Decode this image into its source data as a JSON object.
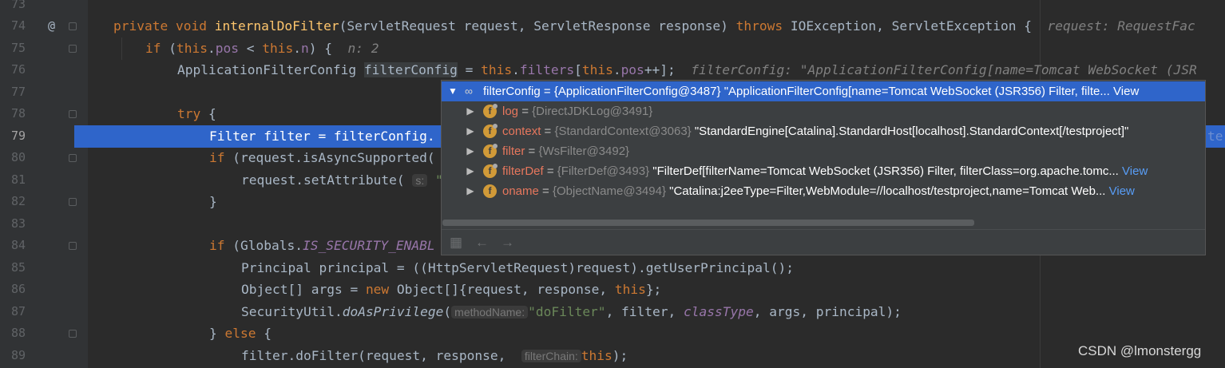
{
  "lines": {
    "l73": "73",
    "l74": "74",
    "l75": "75",
    "l76": "76",
    "l77": "77",
    "l78": "78",
    "l79": "79",
    "l80": "80",
    "l81": "81",
    "l82": "82",
    "l83": "83",
    "l84": "84",
    "l85": "85",
    "l86": "86",
    "l87": "87",
    "l88": "88",
    "l89": "89"
  },
  "gutter_marker": "@",
  "code": {
    "l74": {
      "kw1": "private void ",
      "fn": "internalDoFilter",
      "rest1": "(ServletRequest request, ServletResponse response) ",
      "kw2": "throws",
      "rest2": " IOException, ServletException {",
      "dbg": "request: RequestFac"
    },
    "l75": {
      "kw": "if",
      "rest1": " (",
      "kw2": "this",
      "rest2": ".",
      "fld1": "pos",
      "rest3": " < ",
      "kw3": "this",
      "rest4": ".",
      "fld2": "n",
      "rest5": ") {",
      "dbg": "n: 2"
    },
    "l76": {
      "rest1": "ApplicationFilterConfig ",
      "var": "filterConfig",
      "rest2": " = ",
      "kw": "this",
      "rest3": ".",
      "fld": "filters",
      "rest4": "[",
      "kw2": "this",
      "rest5": ".",
      "fld2": "pos",
      "rest6": "++];",
      "dbg": "filterConfig: \"ApplicationFilterConfig[name=Tomcat WebSocket (JSR"
    },
    "l78": {
      "kw": "try",
      "rest": " {"
    },
    "l79": {
      "text": "Filter filter = filterConfig.",
      "dbg": "ter"
    },
    "l80": {
      "kw": "if",
      "rest": " (request.isAsyncSupported("
    },
    "l81": {
      "rest": "request.setAttribute(",
      "hint": "s:",
      "rest2": " \""
    },
    "l82": {
      "rest": "}"
    },
    "l84": {
      "kw": "if",
      "rest": " (Globals.",
      "fld": "IS_SECURITY_ENABL"
    },
    "l85": {
      "text": "Principal principal = ((HttpServletRequest)request).getUserPrincipal();"
    },
    "l86": {
      "rest1": "Object[] args = ",
      "kw": "new",
      "rest2": " Object[]{request, response, ",
      "kw2": "this",
      "rest3": "};"
    },
    "l87": {
      "rest1": "SecurityUtil.",
      "fn": "doAsPrivilege",
      "rest2": "(",
      "hint": "methodName:",
      "str": "\"doFilter\"",
      "rest3": ", filter, ",
      "fld": "classType",
      "rest4": ", args, principal);"
    },
    "l88": {
      "rest1": "} ",
      "kw": "else",
      "rest2": " {"
    },
    "l89": {
      "rest1": "filter.doFilter(request, response, ",
      "hint": "filterChain:",
      "kw": "this",
      "rest2": ");"
    }
  },
  "popup": {
    "root": {
      "name": "filterConfig",
      "type": "{ApplicationFilterConfig@3487}",
      "value": "\"ApplicationFilterConfig[name=Tomcat WebSocket (JSR356) Filter, filte...",
      "view": "View"
    },
    "fields": [
      {
        "name": "log",
        "type": "{DirectJDKLog@3491}",
        "value": "",
        "view": ""
      },
      {
        "name": "context",
        "type": "{StandardContext@3063}",
        "value": "\"StandardEngine[Catalina].StandardHost[localhost].StandardContext[/testproject]\"",
        "view": ""
      },
      {
        "name": "filter",
        "type": "{WsFilter@3492}",
        "value": "",
        "view": ""
      },
      {
        "name": "filterDef",
        "type": "{FilterDef@3493}",
        "value": "\"FilterDef[filterName=Tomcat WebSocket (JSR356) Filter, filterClass=org.apache.tomc...",
        "view": "View"
      },
      {
        "name": "oname",
        "type": "{ObjectName@3494}",
        "value": "\"Catalina:j2eeType=Filter,WebModule=//localhost/testproject,name=Tomcat Web...",
        "view": "View"
      }
    ],
    "eq": "=",
    "badge": "f"
  },
  "watermark": "CSDN @lmonstergg"
}
